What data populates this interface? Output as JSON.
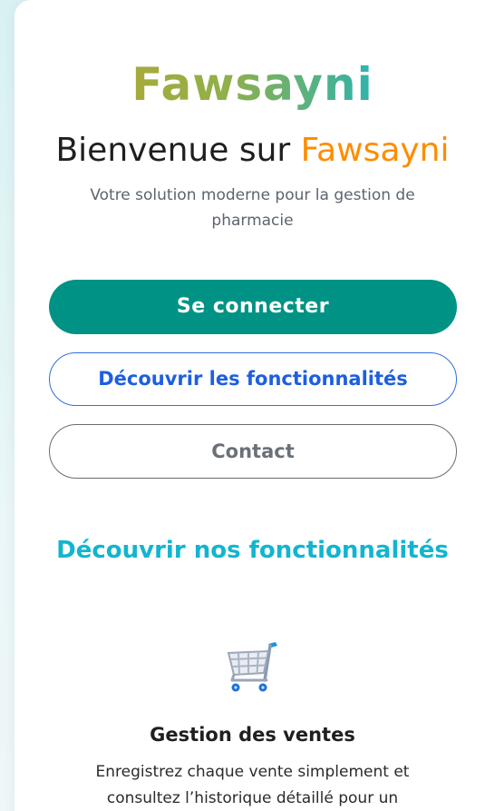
{
  "header": {
    "logo": "Fawsayni",
    "welcome_prefix": "Bienvenue sur ",
    "welcome_brand": "Fawsayni",
    "subtitle": "Votre solution moderne pour la gestion de pharmacie"
  },
  "actions": {
    "login_label": "Se connecter",
    "features_label": "Découvrir les fonctionnalités",
    "contact_label": "Contact"
  },
  "features": {
    "section_title": "Découvrir nos fonctionnalités",
    "items": [
      {
        "icon": "shopping-cart-icon",
        "title": "Gestion des ventes",
        "description": "Enregistrez chaque vente simplement et consultez l’historique détaillé pour un"
      }
    ]
  },
  "colors": {
    "primary": "#009385",
    "accent_orange": "#ff8c00",
    "link_blue": "#1d5fe0",
    "section_cyan": "#12b5d0"
  }
}
